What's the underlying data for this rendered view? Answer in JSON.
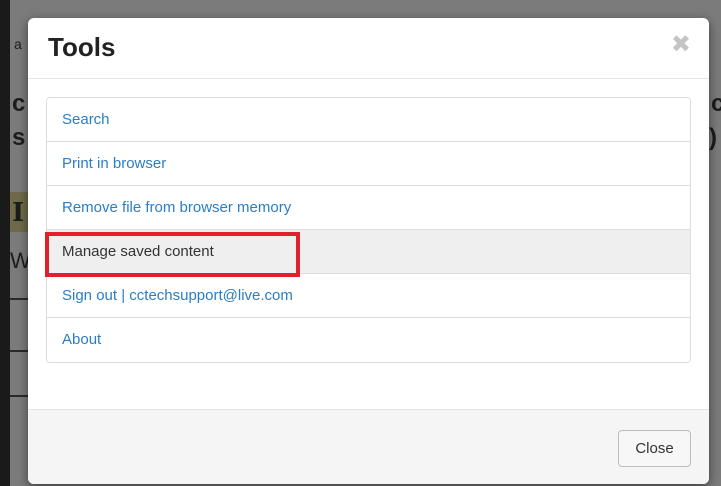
{
  "modal": {
    "title": "Tools",
    "close_icon": "close-icon",
    "items": [
      {
        "label": "Search"
      },
      {
        "label": "Print in browser"
      },
      {
        "label": "Remove file from browser memory"
      },
      {
        "label": "Manage saved content"
      },
      {
        "label": "Sign out | cctechsupport@live.com"
      },
      {
        "label": "About"
      }
    ],
    "close_button_label": "Close"
  },
  "background": {
    "fragments": [
      "a",
      "c",
      "s",
      "I",
      "W",
      "c",
      ")"
    ]
  },
  "colors": {
    "link": "#2a7ec4",
    "highlight_box": "#e0202a",
    "active_row": "#efefef"
  }
}
